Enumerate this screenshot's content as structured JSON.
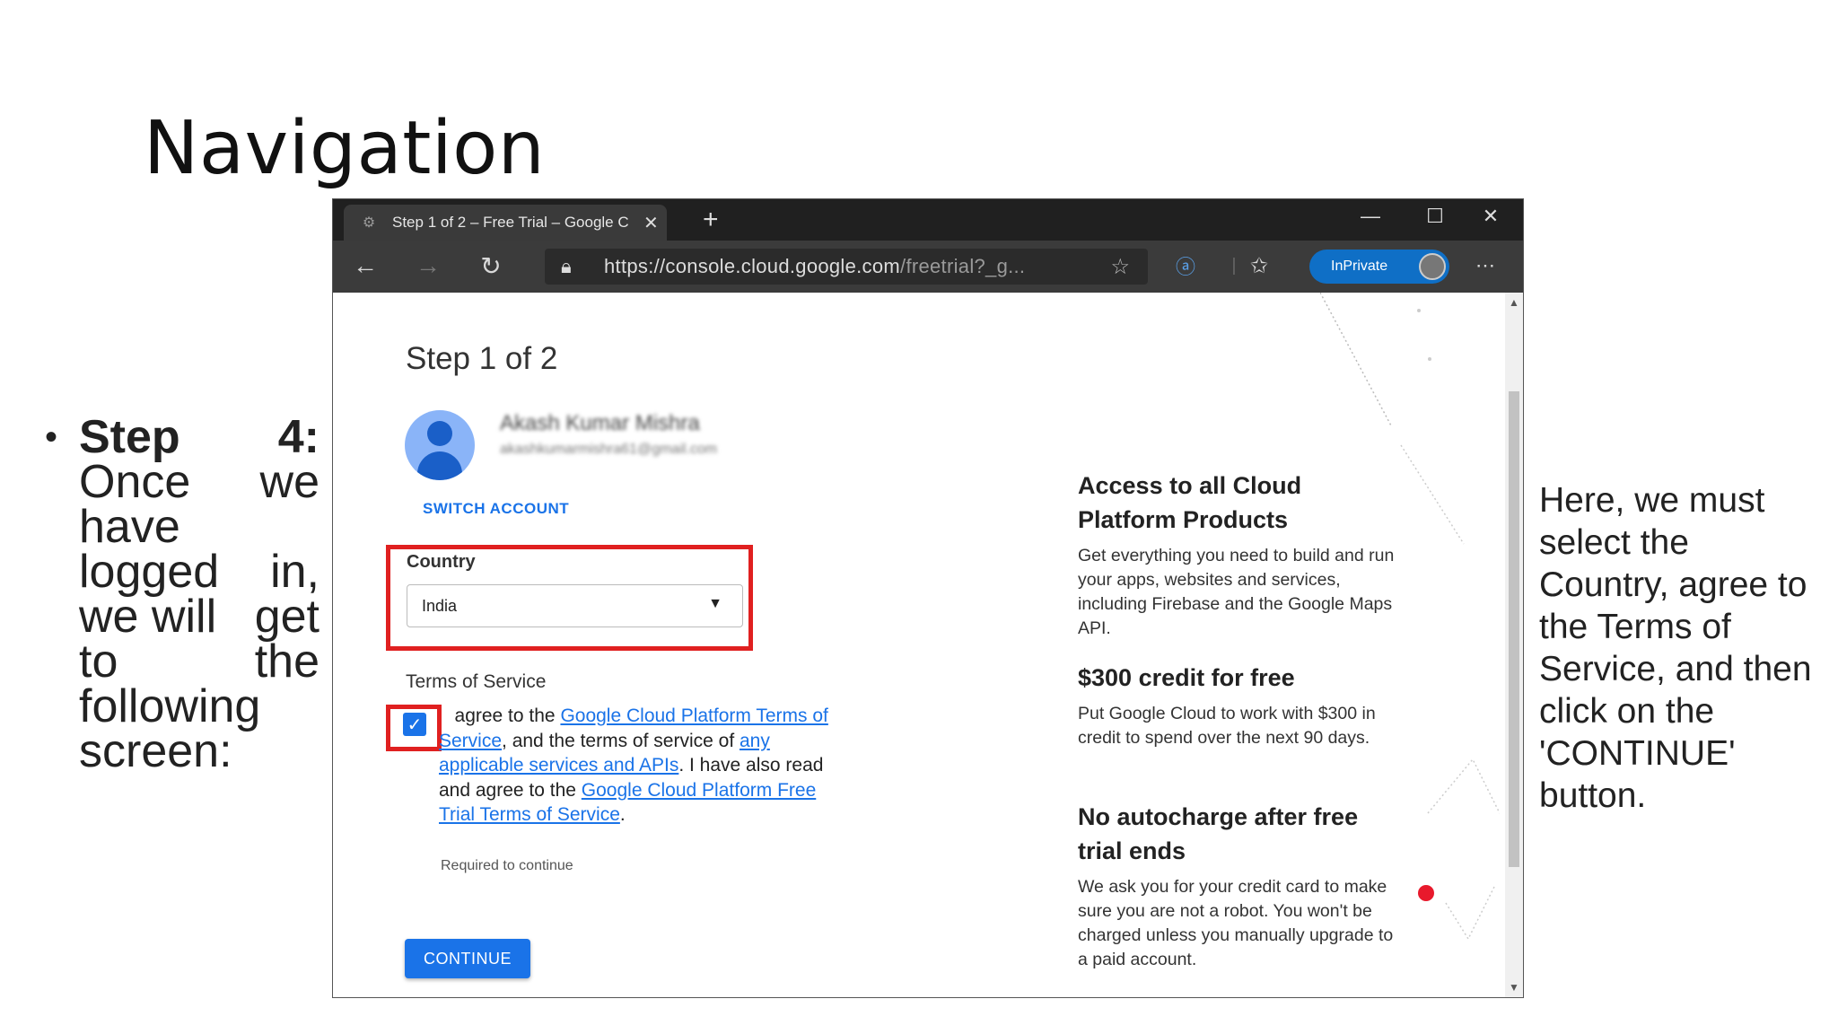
{
  "slide": {
    "title": "Navigation",
    "bullet": {
      "lines": [
        [
          "Step",
          "4:"
        ],
        [
          "Once",
          "we"
        ],
        [
          "have",
          ""
        ],
        [
          "logged",
          "in,"
        ],
        [
          "we will",
          "get"
        ],
        [
          "to",
          "the"
        ],
        [
          "following",
          ""
        ],
        [
          "screen:",
          ""
        ]
      ]
    },
    "side_note": "Here, we must select the Country, agree to the Terms of Service, and then click on the 'CONTINUE' button."
  },
  "browser": {
    "tab_title": "Step 1 of 2 – Free Trial – Google C",
    "new_tab": "+",
    "minimize": "—",
    "maximize": "☐",
    "close": "✕",
    "url_main": "https://console.cloud.google.com",
    "url_rest": "/freetrial?_g...",
    "inprivate_label": "InPrivate"
  },
  "page": {
    "step_title": "Step 1 of 2",
    "account_name": "Akash Kumar Mishra",
    "account_email": "akashkumarmishra61@gmail.com",
    "switch_account": "SWITCH ACCOUNT",
    "country_label": "Country",
    "country_value": "India",
    "tos_label": "Terms of Service",
    "tos_text": {
      "t1": "agree to the ",
      "l1": "Google Cloud Platform Terms of Service",
      "t2": ", and the terms of service of ",
      "l2": "any applicable services and APIs",
      "t3": ". I have also read and agree to the ",
      "l3": "Google Cloud Platform Free Trial Terms of Service",
      "t4": "."
    },
    "required_note": "Required to continue",
    "continue_button": "CONTINUE",
    "promos": [
      {
        "title": "Access to all Cloud Platform Products",
        "text": "Get everything you need to build and run your apps, websites and services, including Firebase and the Google Maps API."
      },
      {
        "title": "$300 credit for free",
        "text": "Put Google Cloud to work with $300 in credit to spend over the next 90 days."
      },
      {
        "title": "No autocharge after free trial ends",
        "text": "We ask you for your credit card to make sure you are not a robot. You won't be charged unless you manually upgrade to a paid account."
      }
    ]
  },
  "colors": {
    "highlight": "#e02020",
    "accent": "#1a73e8",
    "browser_chrome": "#202020"
  }
}
